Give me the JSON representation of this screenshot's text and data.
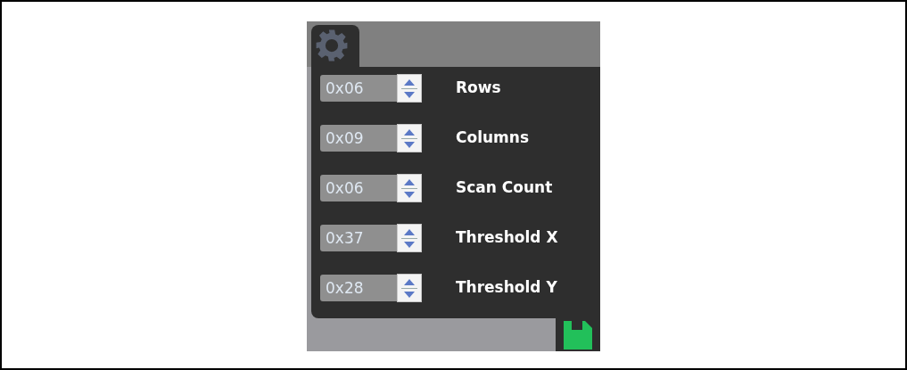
{
  "settings": [
    {
      "value": "0x06",
      "label": "Rows"
    },
    {
      "value": "0x09",
      "label": "Columns"
    },
    {
      "value": "0x06",
      "label": "Scan Count"
    },
    {
      "value": "0x37",
      "label": "Threshold X"
    },
    {
      "value": "0x28",
      "label": "Threshold Y"
    }
  ]
}
